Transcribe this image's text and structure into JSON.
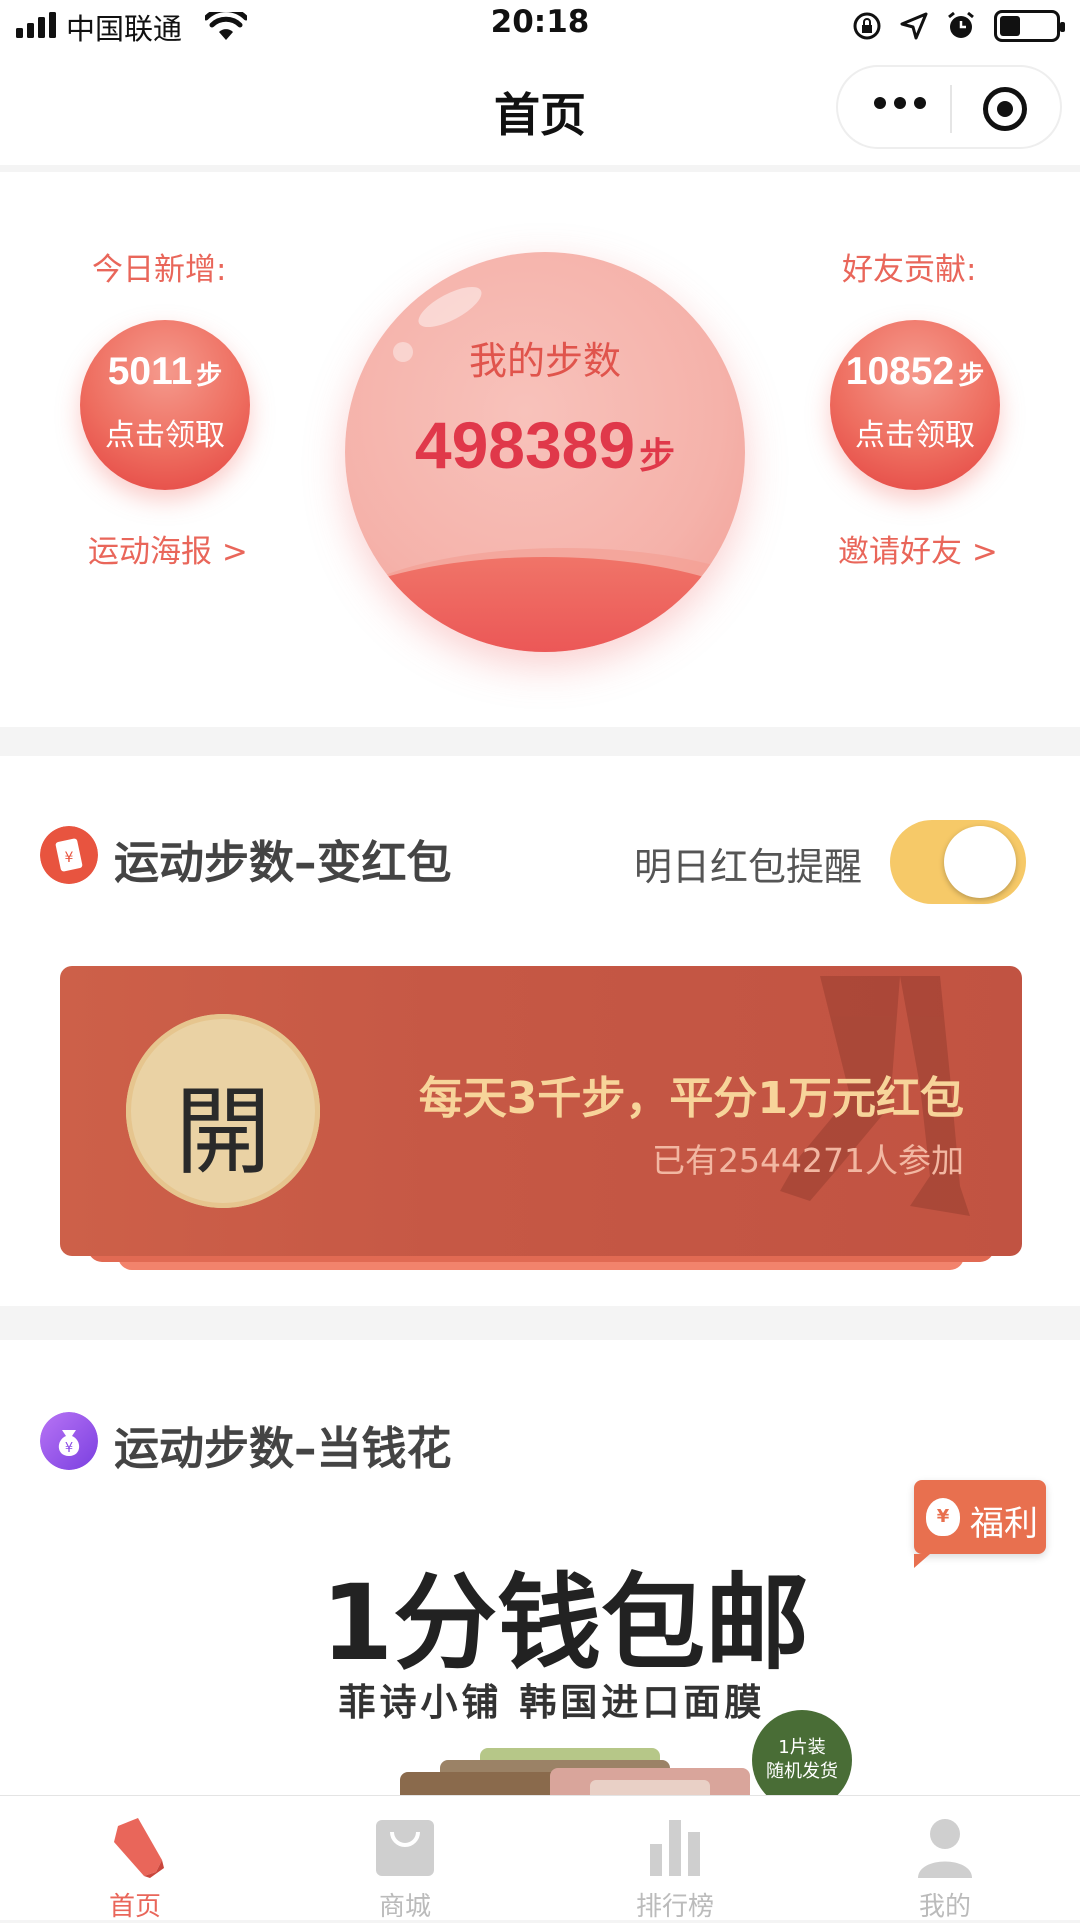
{
  "status_bar": {
    "carrier": "中国联通",
    "time": "20:18"
  },
  "nav": {
    "title": "首页"
  },
  "steps": {
    "today_label": "今日新增:",
    "today_value": "5011",
    "today_unit": "步",
    "today_claim": "点击领取",
    "poster_link": "运动海报 >",
    "my_steps_label": "我的步数",
    "my_steps_value": "498389",
    "my_steps_unit": "步",
    "friend_label": "好友贡献:",
    "friend_value": "10852",
    "friend_unit": "步",
    "friend_claim": "点击领取",
    "invite_link": "邀请好友 >"
  },
  "red_packet": {
    "title": "运动步数–变红包",
    "reminder_label": "明日红包提醒",
    "reminder_on": true,
    "seal_char": "開",
    "headline": "每天3千步，平分1万元红包",
    "joined_text": "已有2544271人参加"
  },
  "spend": {
    "title": "运动步数–当钱花",
    "promo_main": "1分钱包邮",
    "promo_sub": "菲诗小铺  韩国进口面膜",
    "welfare_label": "福利",
    "badge_line1": "1片装",
    "badge_line2": "随机发货"
  },
  "tabbar": {
    "tabs": [
      {
        "label": "首页",
        "icon": "shoe-icon",
        "active": true
      },
      {
        "label": "商城",
        "icon": "shopping-bag-icon",
        "active": false
      },
      {
        "label": "排行榜",
        "icon": "bar-chart-icon",
        "active": false
      },
      {
        "label": "我的",
        "icon": "person-icon",
        "active": false
      }
    ]
  },
  "colors": {
    "accent": "#e9665a",
    "card": "#c65845",
    "toggle": "#f6c968",
    "gold_text": "#f7d49a"
  }
}
